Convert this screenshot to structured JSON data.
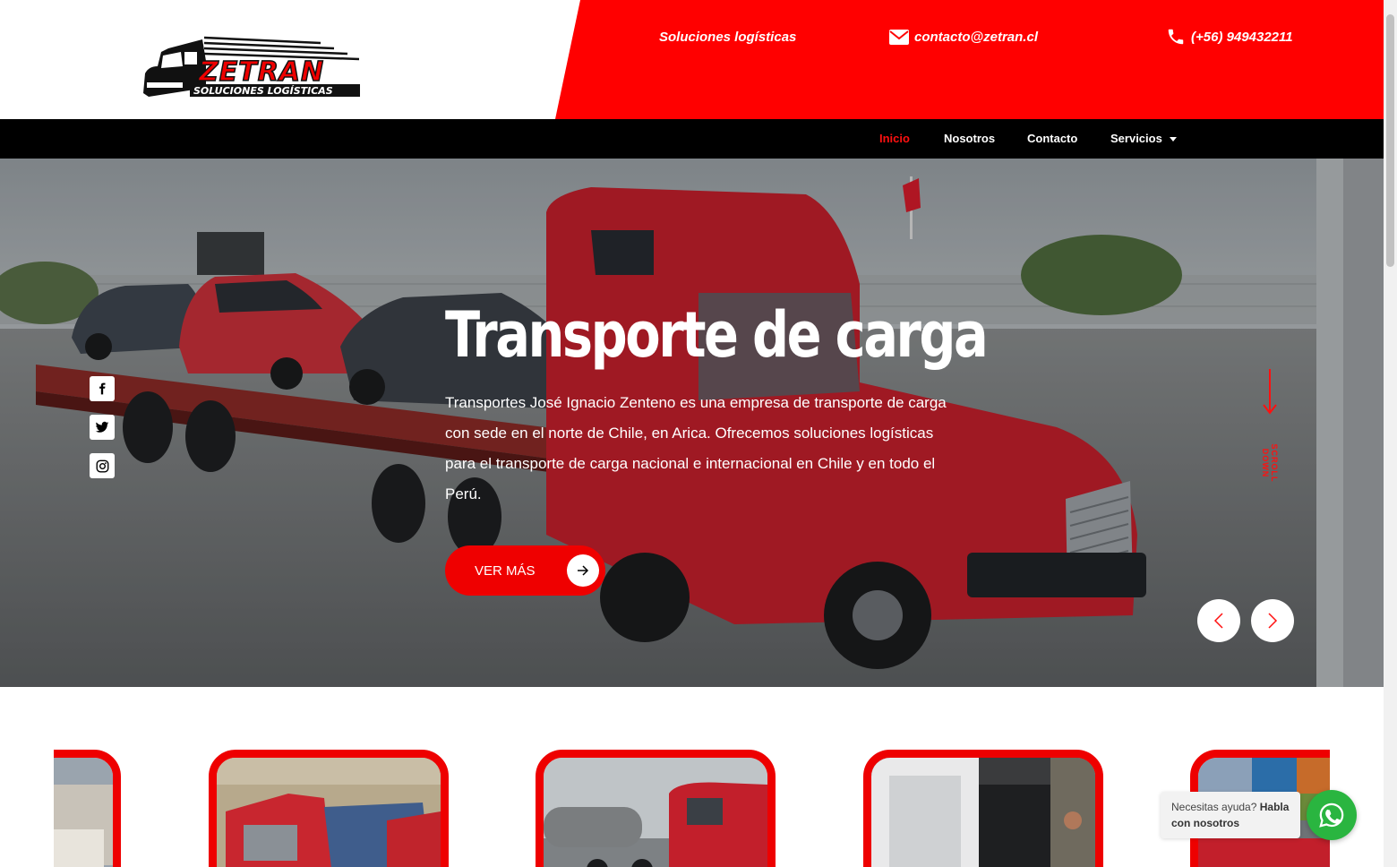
{
  "brand": {
    "logo_name": "ZETRAN",
    "logo_tagline": "SOLUCIONES LOGÍSTICAS",
    "accent_color": "#ff0000"
  },
  "header": {
    "tagline": "Soluciones logísticas",
    "email": "contacto@zetran.cl",
    "phone": "(+56) 949432211"
  },
  "nav": {
    "items": [
      {
        "label": "Inicio",
        "active": true
      },
      {
        "label": "Nosotros"
      },
      {
        "label": "Contacto"
      },
      {
        "label": "Servicios",
        "has_dropdown": true
      }
    ]
  },
  "hero": {
    "title": "Transporte de carga",
    "description": "Transportes José Ignacio Zenteno es una empresa de transporte de carga con sede en el norte de Chile, en Arica. Ofrecemos soluciones logísticas para el transporte de carga nacional e internacional en Chile y en todo el Perú.",
    "cta_label": "VER MÁS",
    "scroll_label": "SCROLL DOWN",
    "social": [
      "facebook-icon",
      "twitter-icon",
      "instagram-icon"
    ]
  },
  "chat": {
    "prompt": "Necesitas ayuda?",
    "action": "Habla con nosotros"
  }
}
